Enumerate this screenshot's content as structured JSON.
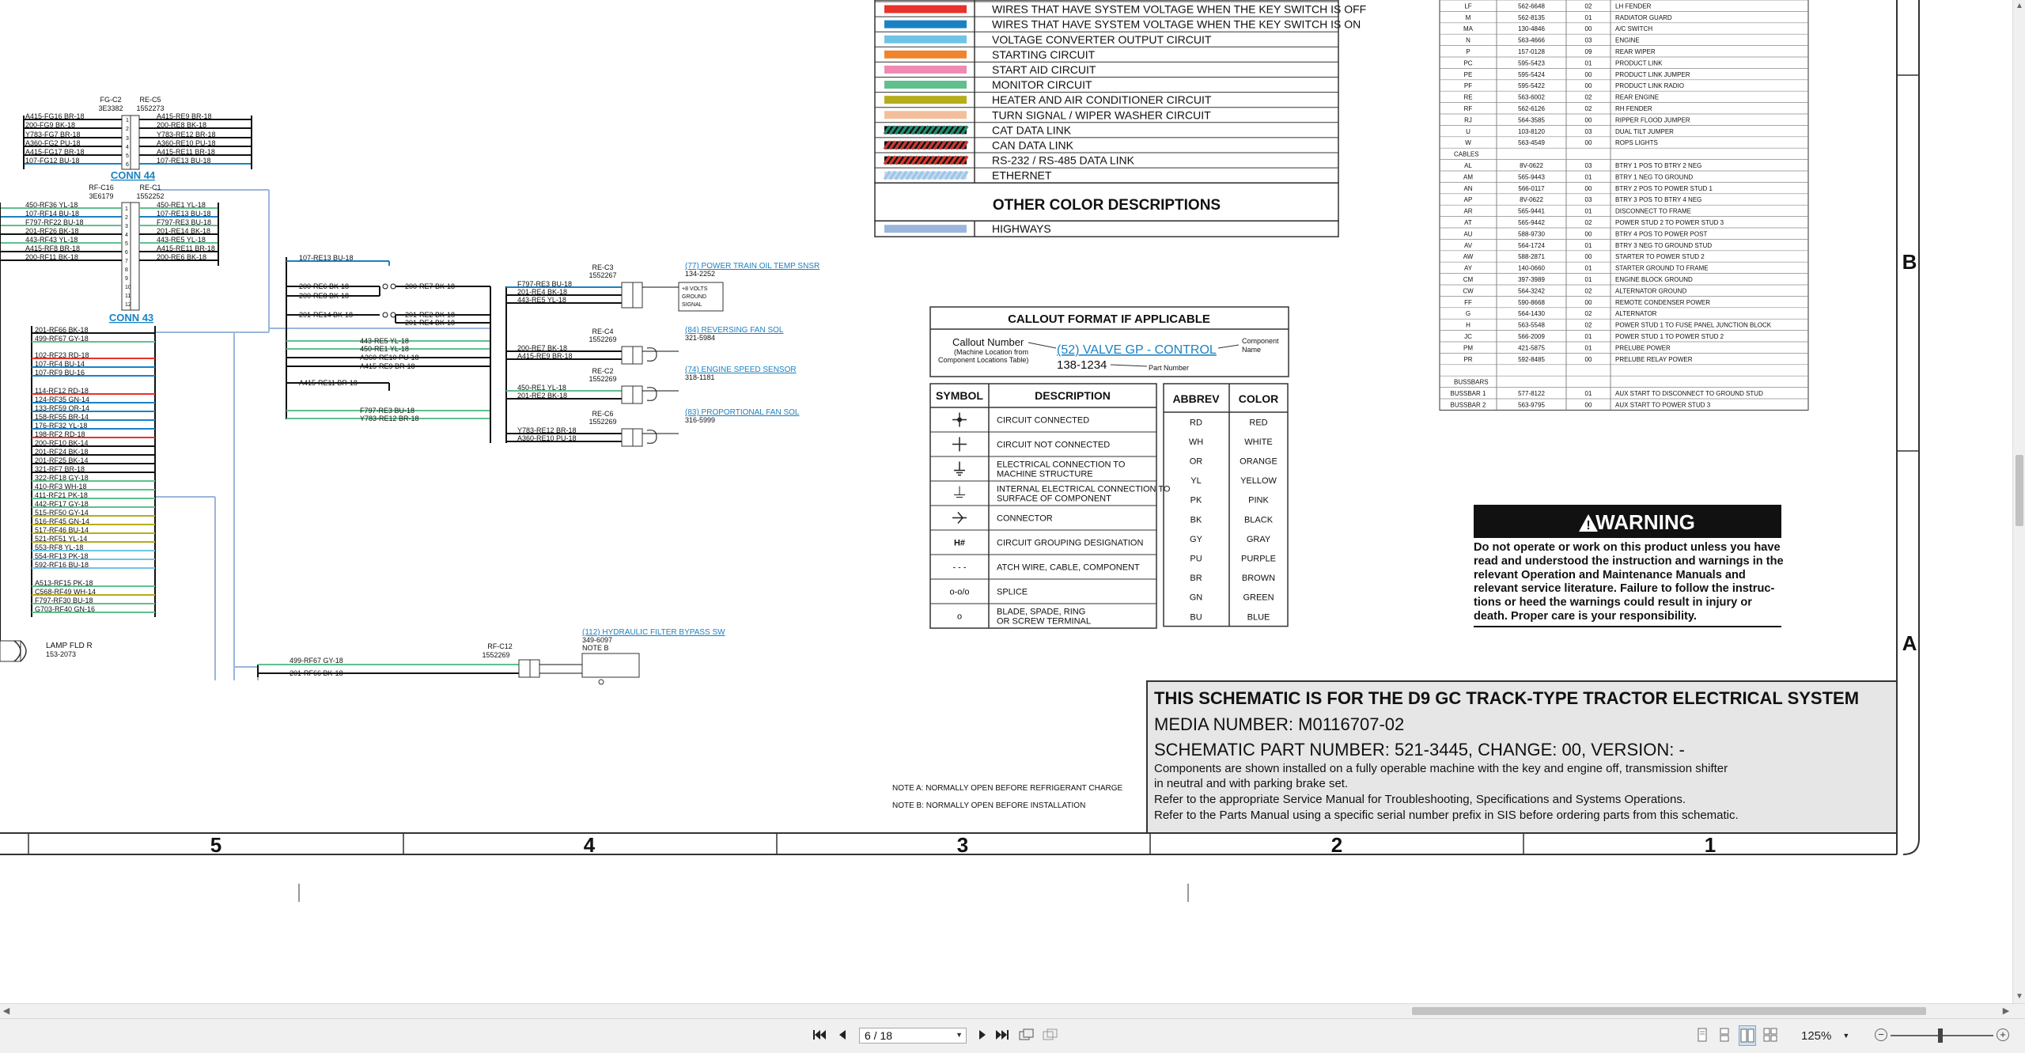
{
  "legend_top": [
    {
      "label": "WIRES THAT HAVE SYSTEM VOLTAGE WHEN THE KEY SWITCH IS OFF",
      "color": "#e8322b"
    },
    {
      "label": "WIRES THAT HAVE SYSTEM VOLTAGE WHEN THE KEY SWITCH IS ON",
      "color": "#1a82c4"
    },
    {
      "label": "VOLTAGE CONVERTER OUTPUT CIRCUIT",
      "color": "#6fc4e6"
    },
    {
      "label": "STARTING CIRCUIT",
      "color": "#f0842c"
    },
    {
      "label": "START AID CIRCUIT",
      "color": "#f08ab4"
    },
    {
      "label": "MONITOR CIRCUIT",
      "color": "#5fc08d"
    },
    {
      "label": "HEATER AND AIR CONDITIONER CIRCUIT",
      "color": "#b5ad1c"
    },
    {
      "label": "TURN SIGNAL / WIPER WASHER CIRCUIT",
      "color": "#f3bf9a"
    },
    {
      "label": "CAT DATA LINK",
      "color": "#1e8f72"
    },
    {
      "label": "CAN DATA LINK",
      "color": "#c83a3a"
    },
    {
      "label": "RS-232 / RS-485 DATA LINK",
      "color": "#d83a2a"
    },
    {
      "label": "ETHERNET",
      "color": "#9ec6e8"
    }
  ],
  "other_color_title": "OTHER COLOR DESCRIPTIONS",
  "other_colors": [
    {
      "label": "HIGHWAYS",
      "color": "#9ab6dc"
    }
  ],
  "callout": {
    "title": "CALLOUT FORMAT IF APPLICABLE",
    "callout_number": "Callout Number",
    "machine_location": "(Machine Location from",
    "component_table": "Component Locations Table)",
    "example": "(52) VALVE GP - CONTROL",
    "component": "Component",
    "name": "Name",
    "part_number_value": "138-1234",
    "part_number": "Part Number"
  },
  "symbols": {
    "header_symbol": "SYMBOL",
    "header_desc": "DESCRIPTION",
    "rows": [
      {
        "sym": "",
        "desc": "CIRCUIT CONNECTED"
      },
      {
        "sym": "",
        "desc": "CIRCUIT NOT CONNECTED"
      },
      {
        "sym": "",
        "desc": "ELECTRICAL CONNECTION TO MACHINE STRUCTURE"
      },
      {
        "sym": "",
        "desc": "INTERNAL ELECTRICAL CONNECTION TO SURFACE OF COMPONENT"
      },
      {
        "sym": "",
        "desc": "CONNECTOR"
      },
      {
        "sym": "H#",
        "desc": "CIRCUIT GROUPING DESIGNATION"
      },
      {
        "sym": "- - -",
        "desc": "ATCH WIRE, CABLE, COMPONENT"
      },
      {
        "sym": "o-o/o",
        "desc": "SPLICE"
      },
      {
        "sym": "o",
        "desc": "BLADE, SPADE, RING OR SCREW TERMINAL"
      }
    ]
  },
  "abbrev": {
    "header_abbrev": "ABBREV",
    "header_color": "COLOR",
    "rows": [
      [
        "RD",
        "RED"
      ],
      [
        "WH",
        "WHITE"
      ],
      [
        "OR",
        "ORANGE"
      ],
      [
        "YL",
        "YELLOW"
      ],
      [
        "PK",
        "PINK"
      ],
      [
        "BK",
        "BLACK"
      ],
      [
        "GY",
        "GRAY"
      ],
      [
        "PU",
        "PURPLE"
      ],
      [
        "BR",
        "BROWN"
      ],
      [
        "GN",
        "GREEN"
      ],
      [
        "BU",
        "BLUE"
      ]
    ]
  },
  "component_table": {
    "rows": [
      [
        "LF",
        "562-6648",
        "02",
        "LH FENDER"
      ],
      [
        "M",
        "562-8135",
        "01",
        "RADIATOR GUARD"
      ],
      [
        "MA",
        "130-4846",
        "00",
        "A/C SWITCH"
      ],
      [
        "N",
        "563-4666",
        "03",
        "ENGINE"
      ],
      [
        "P",
        "157-0128",
        "09",
        "REAR WIPER"
      ],
      [
        "PC",
        "595-5423",
        "01",
        "PRODUCT LINK"
      ],
      [
        "PE",
        "595-5424",
        "00",
        "PRODUCT LINK JUMPER"
      ],
      [
        "PF",
        "595-5422",
        "00",
        "PRODUCT LINK RADIO"
      ],
      [
        "RE",
        "563-6002",
        "02",
        "REAR ENGINE"
      ],
      [
        "RF",
        "562-6126",
        "02",
        "RH FENDER"
      ],
      [
        "RJ",
        "564-3585",
        "00",
        "RIPPER FLOOD JUMPER"
      ],
      [
        "U",
        "103-8120",
        "03",
        "DUAL TILT JUMPER"
      ],
      [
        "W",
        "563-4549",
        "00",
        "ROPS LIGHTS"
      ]
    ],
    "cables_label": "CABLES",
    "cables": [
      [
        "AL",
        "8V-0622",
        "03",
        "BTRY 1 POS TO BTRY 2 NEG"
      ],
      [
        "AM",
        "565-9443",
        "01",
        "BTRY 1 NEG TO GROUND"
      ],
      [
        "AN",
        "566-0117",
        "00",
        "BTRY 2 POS TO POWER STUD 1"
      ],
      [
        "AP",
        "8V-0622",
        "03",
        "BTRY 3 POS TO BTRY 4 NEG"
      ],
      [
        "AR",
        "565-9441",
        "01",
        "DISCONNECT TO FRAME"
      ],
      [
        "AT",
        "565-9442",
        "02",
        "POWER STUD 2 TO POWER STUD 3"
      ],
      [
        "AU",
        "588-9730",
        "00",
        "BTRY 4 POS TO POWER POST"
      ],
      [
        "AV",
        "564-1724",
        "01",
        "BTRY 3 NEG TO GROUND STUD"
      ],
      [
        "AW",
        "588-2871",
        "00",
        "STARTER TO POWER STUD 2"
      ],
      [
        "AY",
        "140-0660",
        "01",
        "STARTER GROUND TO FRAME"
      ],
      [
        "CM",
        "397-3989",
        "01",
        "ENGINE BLOCK GROUND"
      ],
      [
        "CW",
        "564-3242",
        "02",
        "ALTERNATOR GROUND"
      ],
      [
        "FF",
        "590-8668",
        "00",
        "REMOTE CONDENSER POWER"
      ],
      [
        "G",
        "564-1430",
        "02",
        "ALTERNATOR"
      ],
      [
        "H",
        "563-5548",
        "02",
        "POWER STUD 1 TO FUSE PANEL JUNCTION BLOCK"
      ],
      [
        "JC",
        "566-2009",
        "01",
        "POWER STUD 1 TO POWER STUD 2"
      ],
      [
        "PM",
        "421-5875",
        "01",
        "PRELUBE POWER"
      ],
      [
        "PR",
        "592-8485",
        "00",
        "PRELUBE RELAY POWER"
      ]
    ],
    "bussbars_label": "BUSSBARS",
    "bussbars": [
      [
        "BUSSBAR 1",
        "577-8122",
        "01",
        "AUX START TO DISCONNECT TO GROUND STUD"
      ],
      [
        "BUSSBAR 2",
        "563-9795",
        "00",
        "AUX START TO POWER STUD 3"
      ]
    ]
  },
  "warning": {
    "title": "WARNING",
    "text": "Do not operate or work on this product unless you have read and understood the instruction and warnings in the relevant Operation and Maintenance Manuals and relevant service literature. Failure to follow the instructions or heed the warnings could result in injury or death. Proper care is your responsibility."
  },
  "title_block": {
    "line1": "THIS SCHEMATIC IS FOR THE D9 GC TRACK-TYPE TRACTOR ELECTRICAL SYSTEM",
    "line2": "MEDIA NUMBER: M0116707-02",
    "line3": "SCHEMATIC PART NUMBER: 521-3445, CHANGE: 00, VERSION: -",
    "line4": "Components are shown installed on a fully operable machine with the key and engine off, transmission shifter",
    "line5": "in neutral and with parking brake set.",
    "line6": "Refer to the appropriate Service Manual for Troubleshooting, Specifications and Systems Operations.",
    "line7": "Refer to the Parts Manual using a specific serial number prefix in SIS before ordering parts from this schematic."
  },
  "notes": {
    "a": "NOTE A: NORMALLY OPEN BEFORE REFRIGERANT CHARGE",
    "b": "NOTE B: NORMALLY OPEN BEFORE INSTALLATION"
  },
  "grid": {
    "cols": [
      "5",
      "4",
      "3",
      "2",
      "1"
    ],
    "rows": [
      "B",
      "A"
    ]
  },
  "conn44": {
    "title": "CONN 44",
    "left_id": "FG-C2",
    "left_pn": "3E3382",
    "right_id": "RE-C5",
    "right_pn": "1552273",
    "left_wires": [
      "A415-FG16 BR-18",
      "200-FG9 BK-18",
      "Y783-FG7 BR-18",
      "A360-FG2 PU-18",
      "A415-FG17 BR-18",
      "107-FG12 BU-18"
    ],
    "right_wires": [
      "A415-RE9 BR-18",
      "200-RE8 BK-18",
      "Y783-RE12 BR-18",
      "A360-RE10 PU-18",
      "A415-RE11 BR-18",
      "107-RE13 BU-18"
    ]
  },
  "conn43": {
    "title": "CONN 43",
    "left_id": "RF-C16",
    "left_pn": "3E6179",
    "right_id": "RE-C1",
    "right_pn": "1552252",
    "left_wires": [
      "450-RF36 YL-18",
      "107-RF14 BU-18",
      "F797-RF22 BU-18",
      "201-RF26 BK-18",
      "443-RF43 YL-18",
      "A415-RF8 BR-18",
      "200-RF11 BK-18"
    ],
    "right_wires": [
      "450-RE1 YL-18",
      "107-RE13 BU-18",
      "F797-RE3 BU-18",
      "201-RE14 BK-18",
      "443-RE5 YL-18",
      "A415-RE11 BR-18",
      "200-RE6 BK-18"
    ]
  },
  "bus_wires": [
    {
      "t": "201-RF66 BK-18",
      "c": "#111"
    },
    {
      "t": "499-RF67 GY-18",
      "c": "#5fc08d"
    },
    {
      "t": "102-RF23 RD-18",
      "c": "#e8322b"
    },
    {
      "t": "107-RF4 BU-14",
      "c": "#1a82c4"
    },
    {
      "t": "107-RF9 BU-16",
      "c": "#1a82c4"
    },
    {
      "t": "114-RF12 RD-18",
      "c": "#e8322b"
    },
    {
      "t": "124-RF35 GN-14",
      "c": "#1a82c4"
    },
    {
      "t": "133-RF59 OR-14",
      "c": "#1a82c4"
    },
    {
      "t": "158-RF55 BR-14",
      "c": "#1a82c4"
    },
    {
      "t": "176-RF32 YL-18",
      "c": "#1a82c4"
    },
    {
      "t": "198-RF2 RD-18",
      "c": "#e8322b"
    },
    {
      "t": "200-RF10 BK-14",
      "c": "#111"
    },
    {
      "t": "201-RF24 BK-18",
      "c": "#111"
    },
    {
      "t": "201-RF25 BK-14",
      "c": "#111"
    },
    {
      "t": "321-RF7 BR-18",
      "c": "#111"
    },
    {
      "t": "322-RF18 GY-18",
      "c": "#5fc08d"
    },
    {
      "t": "410-RF3 WH-18",
      "c": "#5fc08d"
    },
    {
      "t": "411-RF21 PK-18",
      "c": "#5fc08d"
    },
    {
      "t": "442-RF17 GY-18",
      "c": "#5fc08d"
    },
    {
      "t": "515-RF50 GY-14",
      "c": "#b5ad1c"
    },
    {
      "t": "516-RF45 GN-14",
      "c": "#b5ad1c"
    },
    {
      "t": "517-RF46 BU-14",
      "c": "#b5ad1c"
    },
    {
      "t": "521-RF51 YL-14",
      "c": "#b5ad1c"
    },
    {
      "t": "553-RF8 YL-18",
      "c": "#6fc4e6"
    },
    {
      "t": "554-RF13 PK-18",
      "c": "#6fc4e6"
    },
    {
      "t": "592-RF16 BU-18",
      "c": "#6fc4e6"
    },
    {
      "t": "A513-RF15 PK-18",
      "c": "#5fc08d"
    },
    {
      "t": "C568-RF49 WH-14",
      "c": "#b5ad1c"
    },
    {
      "t": "F797-RF30 BU-18",
      "c": "#5fc08d"
    },
    {
      "t": "G703-RF40 GN-16",
      "c": "#5fc08d"
    }
  ],
  "lamp": {
    "name": "LAMP FLD R",
    "pn": "153-2073"
  },
  "mid_wires": {
    "re13": "107-RE13 BU-18",
    "re8": "200-RE8 BK-18",
    "re6": "200-RE6 BK-18",
    "re7": "200-RE7 BK-18",
    "re14": "201-RE14 BK-18",
    "re2": "201-RE2 BK-18",
    "re4": "201-RE4 BK-18",
    "re5": "443-RE5 YL-18",
    "re1": "450-RE1 YL-18",
    "re10": "A360-RE10 PU-18",
    "re9": "A415-RE9 BR-18",
    "re11": "A415-RE11 BR-18",
    "re3": "F797-RE3 BU-18",
    "re12": "Y783-RE12 BR-18"
  },
  "sensors": [
    {
      "id": "RE-C3",
      "pn": "1552267",
      "link": "(77) POWER TRAIN OIL TEMP SNSR",
      "part": "134-2252",
      "wires": [
        "F797-RE3 BU-18",
        "201-RE4 BK-18",
        "443-RE5 YL-18"
      ],
      "pins": [
        "+8 VOLTS",
        "GROUND",
        "SIGNAL"
      ]
    },
    {
      "id": "RE-C4",
      "pn": "1552269",
      "link": "(84) REVERSING FAN SOL",
      "part": "321-5984",
      "wires": [
        "200-RE7 BK-18",
        "A415-RE9 BR-18"
      ]
    },
    {
      "id": "RE-C2",
      "pn": "1552269",
      "link": "(74) ENGINE SPEED SENSOR",
      "part": "318-1181",
      "wires": [
        "450-RE1 YL-18",
        "201-RE2 BK-18"
      ]
    },
    {
      "id": "RE-C6",
      "pn": "1552269",
      "link": "(83) PROPORTIONAL FAN SOL",
      "part": "316-5999",
      "wires": [
        "Y783-RE12 BR-18",
        "A360-RE10 PU-18"
      ]
    }
  ],
  "bypass": {
    "id": "RF-C12",
    "pn": "1552269",
    "link": "(112) HYDRAULIC FILTER BYPASS SW",
    "part": "349-6097",
    "note": "NOTE B",
    "wires": [
      "499-RF67 GY-18",
      "201-RF66 BK-18"
    ]
  },
  "toolbar": {
    "page_value": "6 / 18",
    "zoom": "125%"
  }
}
